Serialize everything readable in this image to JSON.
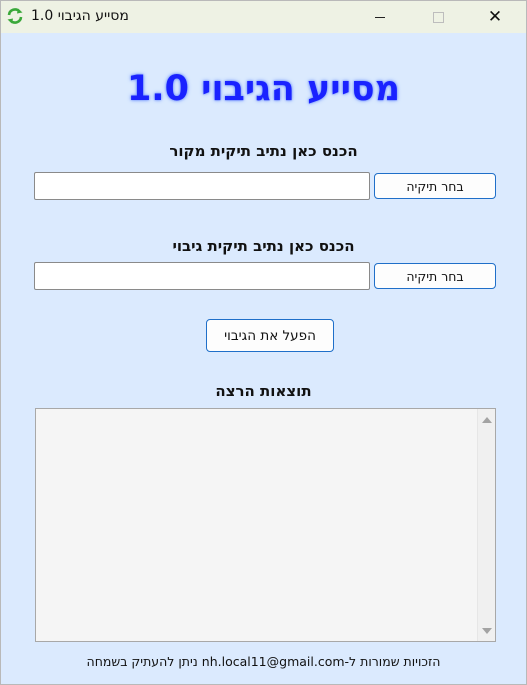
{
  "window": {
    "title": "מסייע הגיבוי 1.0",
    "app_icon": "refresh-arrows-icon",
    "minimize_icon": "minimize-icon",
    "maximize_icon": "maximize-icon",
    "close_icon": "close-icon",
    "close_glyph": "✕"
  },
  "main": {
    "heading": "מסייע הגיבוי 1.0",
    "heading_color": "#1a22ff",
    "source": {
      "label": "הכנס כאן נתיב תיקית מקור",
      "value": "",
      "browse_label": "בחר תיקיה"
    },
    "backup": {
      "label": "הכנס כאן נתיב תיקית גיבוי",
      "value": "",
      "browse_label": "בחר תיקיה"
    },
    "run_label": "הפעל את הגיבוי",
    "results_label": "תוצאות הרצה",
    "results_text": ""
  },
  "footer": {
    "text": "הזכויות שמורות ל-nh.local11@gmail.com ניתן להעתיק בשמחה"
  },
  "colors": {
    "background": "#dbeafe",
    "button_border": "#1f6fc9",
    "titlebar": "#eef2e4"
  }
}
